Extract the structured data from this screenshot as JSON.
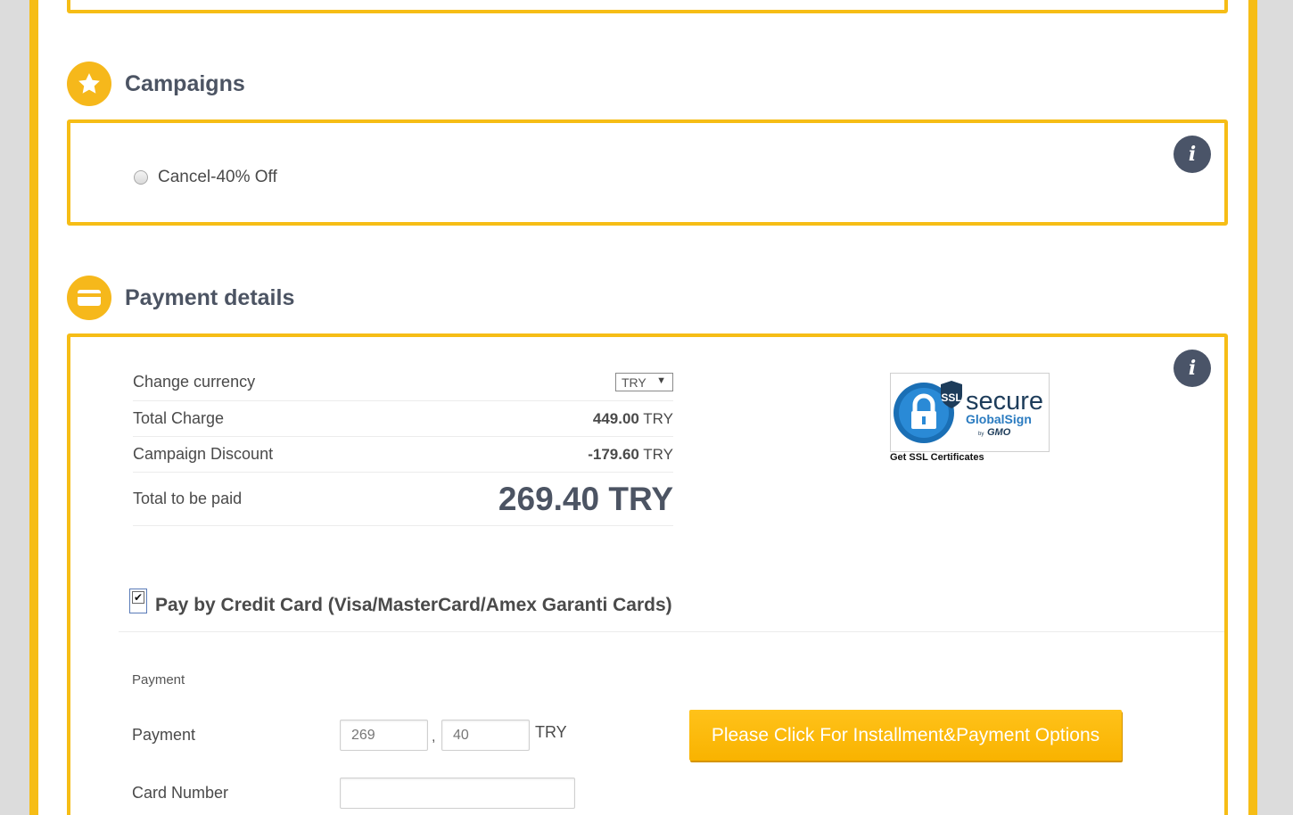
{
  "campaigns": {
    "title": "Campaigns",
    "icon": "star-icon",
    "options": [
      {
        "label": "Cancel-40% Off",
        "selected": false
      }
    ],
    "info_label": "i"
  },
  "payment_details": {
    "title": "Payment details",
    "icon": "credit-card-icon",
    "info_label": "i",
    "change_currency_label": "Change currency",
    "currency_selected": "TRY",
    "total_charge_label": "Total Charge",
    "total_charge_amount": "449.00",
    "total_charge_currency": "TRY",
    "campaign_discount_label": "Campaign Discount",
    "campaign_discount_amount": "-179.60",
    "campaign_discount_currency": "TRY",
    "total_to_pay_label": "Total to be paid",
    "total_to_pay_value": "269.40 TRY"
  },
  "ssl_badge": {
    "ssl_text": "SSL",
    "secure_text": "secure",
    "brand_text": "GlobalSign",
    "by_text": "by",
    "gmo_text": "GMO",
    "caption": "Get SSL Certificates"
  },
  "credit_card": {
    "checked": true,
    "label": "Pay by Credit Card (Visa/MasterCard/Amex Garanti Cards)",
    "section_label": "Payment",
    "payment_label": "Payment",
    "payment_whole": "269",
    "payment_fraction": "40",
    "separator": ",",
    "payment_currency": "TRY",
    "card_number_label": "Card Number",
    "card_number_value": "",
    "installment_button": "Please Click For Installment&Payment Options"
  },
  "colors": {
    "accent": "#f6bd16",
    "heading": "#4c5463",
    "info_button": "#4a5468"
  }
}
